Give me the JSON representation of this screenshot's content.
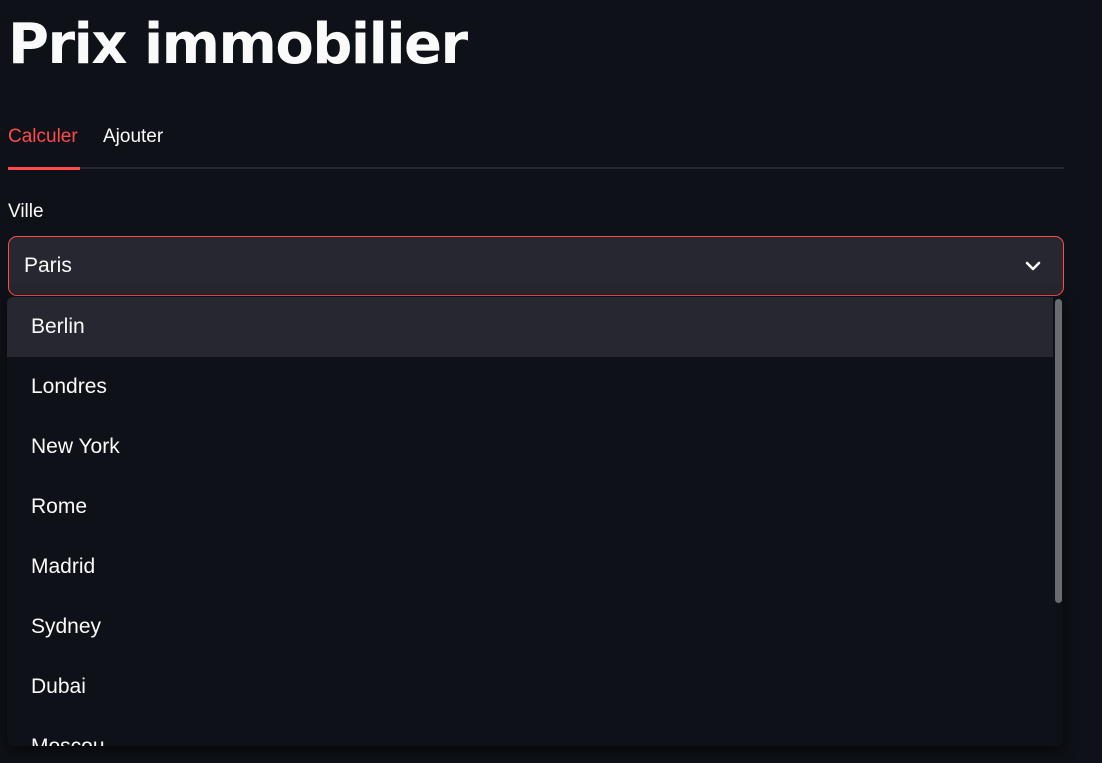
{
  "app": {
    "title": "Prix immobilier"
  },
  "tabs": [
    {
      "label": "Calculer",
      "active": true
    },
    {
      "label": "Ajouter",
      "active": false
    }
  ],
  "form": {
    "city_label": "Ville",
    "city_selected": "Paris"
  },
  "dropdown": {
    "options": [
      "Berlin",
      "Londres",
      "New York",
      "Rome",
      "Madrid",
      "Sydney",
      "Dubai",
      "Moscou"
    ],
    "highlighted_index": 0
  },
  "icons": {
    "select_toggle": "chevron-down-icon"
  },
  "colors": {
    "accent": "#ff4b4b",
    "background": "#0e1117",
    "surface": "#262730",
    "text": "#fafafa"
  }
}
